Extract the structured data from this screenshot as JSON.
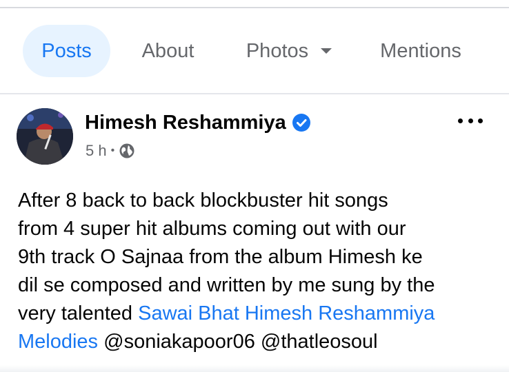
{
  "tabs": [
    {
      "label": "Posts",
      "active": true
    },
    {
      "label": "About",
      "active": false
    },
    {
      "label": "Photos",
      "active": false
    },
    {
      "label": "Mentions",
      "active": false
    }
  ],
  "post": {
    "author": "Himesh Reshammiya",
    "verified": true,
    "time": "5 h",
    "separator": "•",
    "privacy_icon": "globe-icon",
    "more_icon": "more-options-icon",
    "text_lines": {
      "l1": "After 8 back to back blockbuster hit songs",
      "l2": "from 4 super hit albums coming out with our",
      "l3": "9th track O Sajnaa from the album Himesh ke",
      "l4": "dil se composed and written by me sung by the",
      "l5_prefix": "very talented ",
      "l5_link": "Sawai Bhat Himesh Reshammiya",
      "l6_link": "Melodies",
      "l6_mention1": "@soniakapoor06",
      "l6_mention2": "@thatleosoul"
    }
  },
  "colors": {
    "accent": "#1877f2",
    "active_tab_bg": "#e7f3ff",
    "muted": "#65676b",
    "text": "#050505"
  }
}
